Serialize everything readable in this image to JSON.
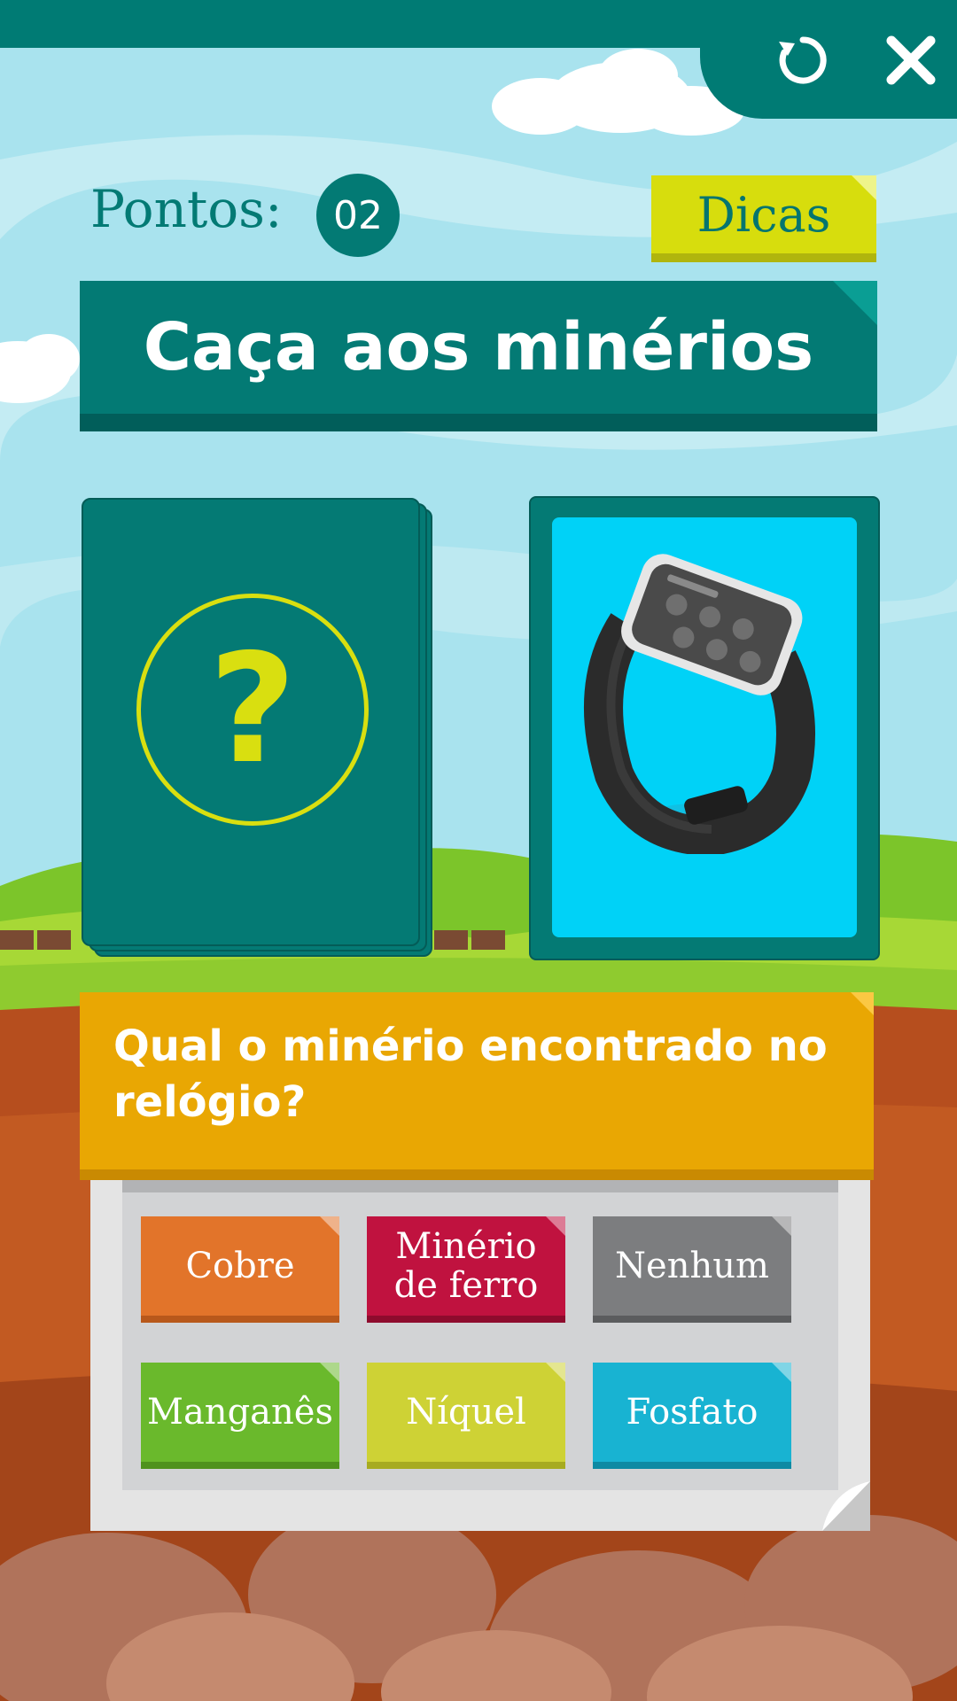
{
  "header": {
    "score_label": "Pontos:",
    "score_value": "02",
    "tips_label": "Dicas",
    "restart_icon": "restart-icon",
    "close_icon": "close-icon"
  },
  "title": "Caça aos minérios",
  "cards": {
    "deck_icon": "question-mark-icon",
    "deck_symbol": "?",
    "object_icon": "smartwatch-icon"
  },
  "question": "Qual o minério encontrado no relógio?",
  "options": [
    {
      "label": "Cobre",
      "color": "#e2742a"
    },
    {
      "label": "Minério de ferro",
      "color": "#c0123f"
    },
    {
      "label": "Nenhum",
      "color": "#7c7d7f"
    },
    {
      "label": "Manganês",
      "color": "#6ab92c"
    },
    {
      "label": "Níquel",
      "color": "#ced235"
    },
    {
      "label": "Fosfato",
      "color": "#18b3d2"
    }
  ],
  "colors": {
    "primary": "#037a74",
    "accent": "#d7dd0d",
    "question_bg": "#e9a703",
    "card_face": "#00d2f7"
  }
}
